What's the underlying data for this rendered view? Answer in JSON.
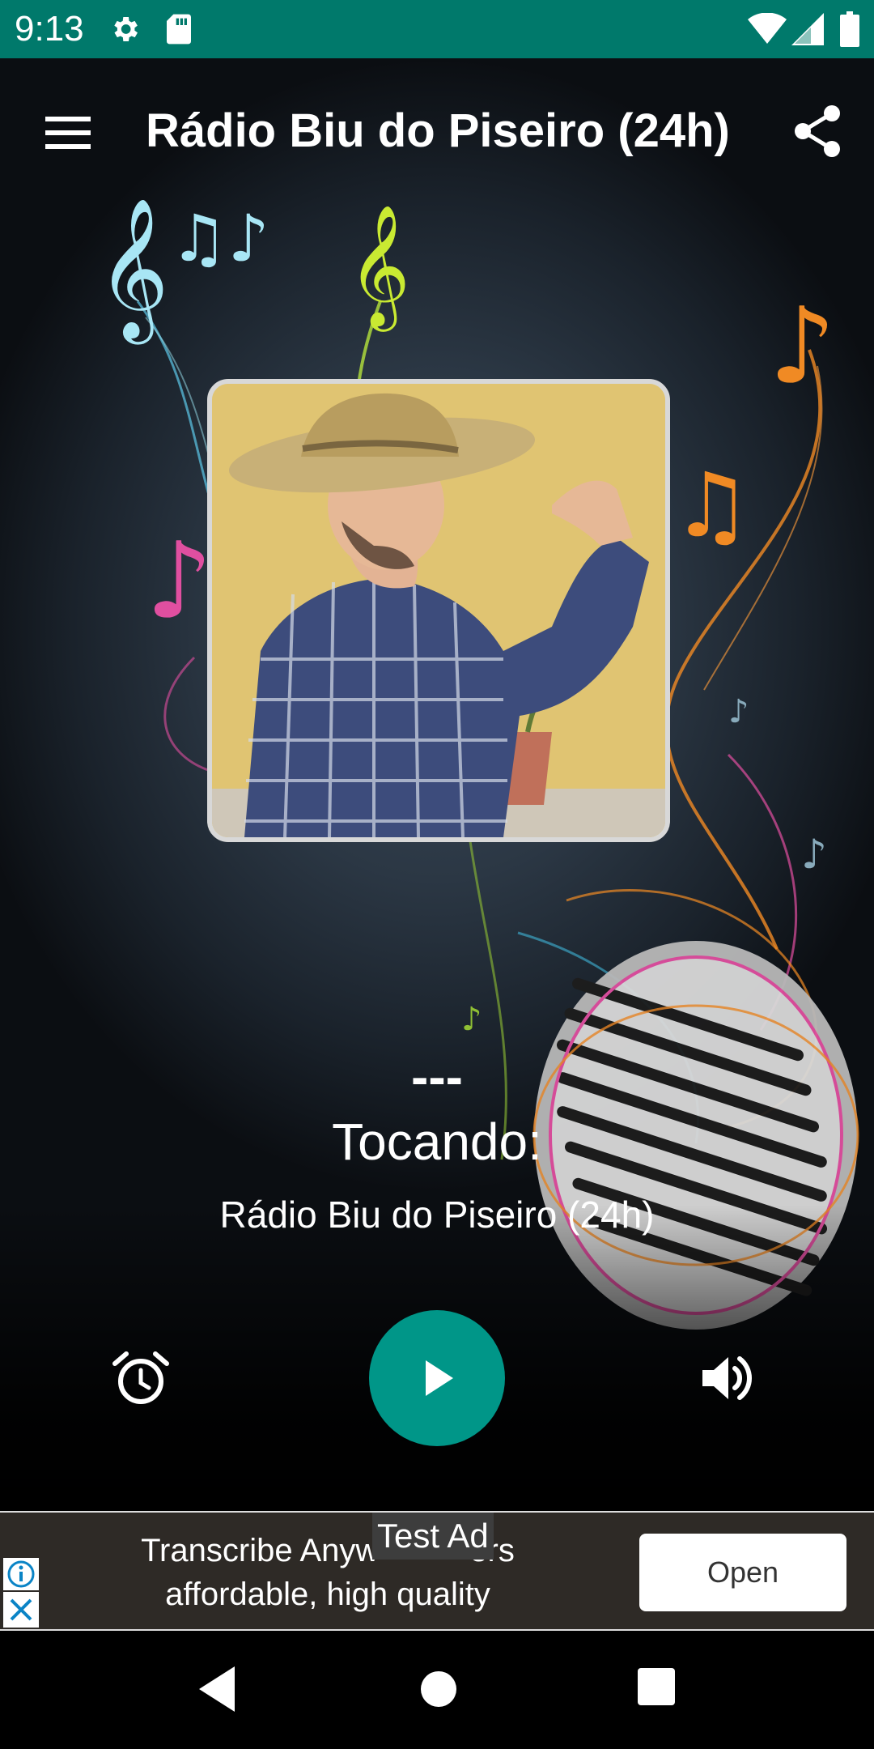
{
  "status_bar": {
    "time": "9:13",
    "icons": [
      "gear-icon",
      "sd-card-icon",
      "wifi-icon",
      "signal-icon",
      "battery-icon"
    ],
    "background_color": "#00796b"
  },
  "toolbar": {
    "title": "Rádio Biu do Piseiro (24h)",
    "menu_icon": "hamburger-menu-icon",
    "share_icon": "share-icon"
  },
  "player": {
    "track_title": "---",
    "status_label": "Tocando:",
    "station_name": "Rádio Biu do Piseiro (24h)",
    "alarm_icon": "alarm-clock-icon",
    "play_icon": "play-icon",
    "volume_icon": "volume-icon",
    "accent_color": "#009688"
  },
  "ad": {
    "text_line1": "Transcribe Anyw",
    "text_line1_end": "ers",
    "text_line2": "affordable, high quality",
    "badge": "Test Ad",
    "button_label": "Open",
    "info_icon": "info-icon",
    "close_icon": "close-icon"
  },
  "nav_bar": {
    "icons": [
      "back-icon",
      "home-icon",
      "recents-icon"
    ]
  }
}
